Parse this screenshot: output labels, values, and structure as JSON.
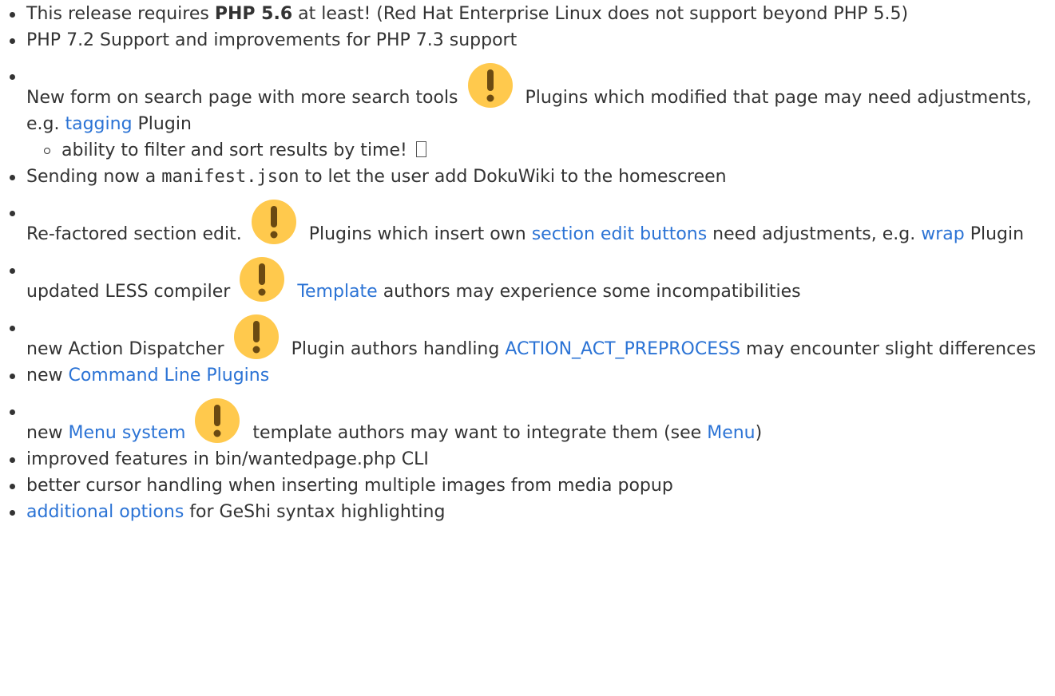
{
  "colors": {
    "text": "#333333",
    "link": "#2b73d5",
    "warning_icon": "#ffc94d",
    "warning_mark": "#6b4a12"
  },
  "icons": {
    "warning": "exclamation-warning-icon",
    "missing_glyph": "missing-glyph-icon"
  },
  "items": {
    "php56": {
      "pre": "This release requires ",
      "bold": "PHP 5.6",
      "post": " at least! (Red Hat Enterprise Linux does not support beyond PHP 5.5)"
    },
    "php72": {
      "text": "PHP 7.2 Support and improvements for PHP 7.3 support"
    },
    "search": {
      "pre": "New form on search page with more search tools",
      "mid": "Plugins which modified that page may need adjustments, e.g. ",
      "link": "tagging",
      "post": " Plugin",
      "sub": "ability to filter and sort results by time! "
    },
    "manifest": {
      "pre": "Sending now a ",
      "code": "manifest.json",
      "post": " to let the user add DokuWiki to the homescreen"
    },
    "section_edit": {
      "pre": "Re-factored section edit.",
      "mid": "Plugins which insert own ",
      "link1": "section edit buttons",
      "mid2": " need adjustments, e.g. ",
      "link2": "wrap",
      "post": " Plugin"
    },
    "less": {
      "pre": "updated LESS compiler",
      "link": "Template",
      "post": " authors may experience some incompatibilities"
    },
    "dispatcher": {
      "pre": "new Action Dispatcher",
      "mid": "Plugin authors handling ",
      "link": "ACTION_ACT_PREPROCESS",
      "post": " may encounter slight differences"
    },
    "cli": {
      "pre": "new ",
      "link": "Command Line Plugins"
    },
    "menu": {
      "pre": "new ",
      "link1": "Menu system",
      "mid": "template authors may want to integrate them (see ",
      "link2": "Menu",
      "post": ")"
    },
    "wantedpage": {
      "text": "improved features in bin/wantedpage.php CLI"
    },
    "cursor": {
      "text": "better cursor handling when inserting multiple images from media popup"
    },
    "geshi": {
      "link": "additional options",
      "post": " for GeShi syntax highlighting"
    }
  }
}
